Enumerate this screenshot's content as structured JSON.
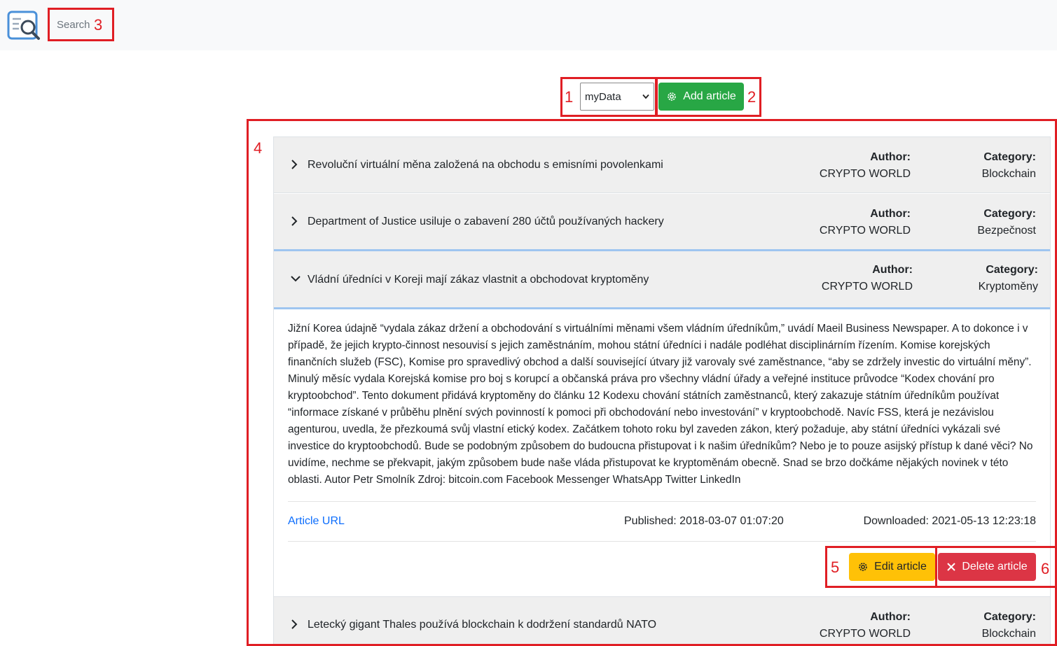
{
  "nav": {
    "search_placeholder": "Search"
  },
  "controls": {
    "source_selected": "myData",
    "add_label": "Add article"
  },
  "markers": [
    "1",
    "2",
    "3",
    "4",
    "5",
    "6"
  ],
  "articles": [
    {
      "title": "Revoluční virtuální měna založená na obchodu s emisními povolenkami",
      "author_label": "Author:",
      "author": "CRYPTO WORLD",
      "category_label": "Category:",
      "category": "Blockchain",
      "expanded": false
    },
    {
      "title": "Department of Justice usiluje o zabavení 280 účtů používaných hackery",
      "author_label": "Author:",
      "author": "CRYPTO WORLD",
      "category_label": "Category:",
      "category": "Bezpečnost",
      "expanded": false
    },
    {
      "title": "Vládní úředníci v Koreji mají zákaz vlastnit a obchodovat kryptoměny",
      "author_label": "Author:",
      "author": "CRYPTO WORLD",
      "category_label": "Category:",
      "category": "Kryptoměny",
      "expanded": true,
      "body": "Jižní Korea údajně “vydala zákaz držení a obchodování s virtuálními měnami všem vládním úředníkům,” uvádí Maeil Business Newspaper. A to dokonce i v případě, že jejich krypto-činnost nesouvisí s jejich zaměstnáním, mohou státní úředníci i nadále podléhat disciplinárním řízením. Komise korejských finančních služeb (FSC), Komise pro spravedlivý obchod a další související útvary již varovaly své zaměstnance, “aby se zdržely investic do virtuální měny”. Minulý měsíc vydala Korejská komise pro boj s korupcí a občanská práva pro všechny vládní úřady a veřejné instituce průvodce “Kodex chování pro kryptoobchod”. Tento dokument přidává kryptoměny do článku 12 Kodexu chování státních zaměstnanců, který zakazuje státním úředníkům používat “informace získané v průběhu plnění svých povinností k pomoci při obchodování nebo investování” v kryptoobchodě. Navíc FSS, která je nezávislou agenturou, uvedla, že přezkoumá svůj vlastní etický kodex. Začátkem tohoto roku byl zaveden zákon, který požaduje, aby státní úředníci vykázali své investice do kryptoobchodů. Bude se podobným způsobem do budoucna přistupovat i k našim úředníkům? Nebo je to pouze asijský přístup k dané věci? No uvidíme, nechme se překvapit, jakým způsobem bude naše vláda přistupovat ke kryptoměnám obecně. Snad se brzo dočkáme nějakých novinek v této oblasti. Autor Petr Smolník Zdroj: bitcoin.com Facebook Messenger WhatsApp Twitter LinkedIn",
      "url_label": "Article URL",
      "published": "Published: 2018-03-07 01:07:20",
      "downloaded": "Downloaded: 2021-05-13 12:23:18",
      "edit_label": "Edit article",
      "delete_label": "Delete article"
    },
    {
      "title": "Letecký gigant Thales používá blockchain k dodržení standardů NATO",
      "author_label": "Author:",
      "author": "CRYPTO WORLD",
      "category_label": "Category:",
      "category": "Blockchain",
      "expanded": false
    }
  ],
  "colors": {
    "navbar_bg": "#f8f9fa",
    "success": "#28a745",
    "warning": "#ffc107",
    "danger": "#dc3545",
    "link": "#0d6efd",
    "marker": "#e01e24"
  }
}
